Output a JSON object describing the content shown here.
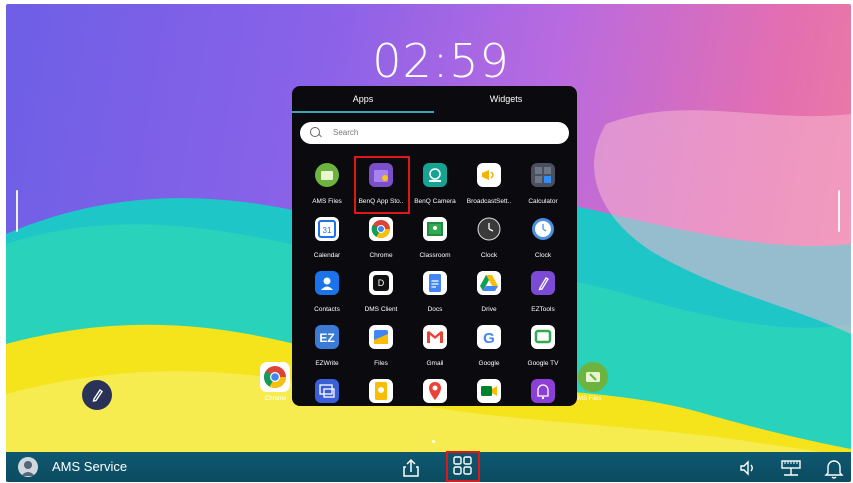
{
  "clock": {
    "time": "02:59"
  },
  "drawer": {
    "tabs": [
      {
        "label": "Apps",
        "active": true
      },
      {
        "label": "Widgets",
        "active": false
      }
    ],
    "search_placeholder": "Search",
    "apps": [
      {
        "label": "AMS Files",
        "icon": "ams-files-icon",
        "color": "#6db33f"
      },
      {
        "label": "BenQ App Sto..",
        "icon": "benq-app-store-icon",
        "color": "#7a4fc9",
        "highlighted": true
      },
      {
        "label": "BenQ Camera",
        "icon": "benq-camera-icon",
        "color": "#16a394"
      },
      {
        "label": "BroadcastSett..",
        "icon": "broadcast-settings-icon",
        "color": "#f5b400"
      },
      {
        "label": "Calculator",
        "icon": "calculator-icon",
        "color": "#4a5060"
      },
      {
        "label": "Calendar",
        "icon": "calendar-icon",
        "color": "#ffffff"
      },
      {
        "label": "Chrome",
        "icon": "chrome-icon",
        "color": "#ffffff"
      },
      {
        "label": "Classroom",
        "icon": "classroom-icon",
        "color": "#ffffff"
      },
      {
        "label": "Clock",
        "icon": "clock-icon",
        "color": "#2b2b2b"
      },
      {
        "label": "Clock",
        "icon": "clock-icon",
        "color": "#4a90e2"
      },
      {
        "label": "Contacts",
        "icon": "contacts-icon",
        "color": "#1a73e8"
      },
      {
        "label": "DMS Client",
        "icon": "dms-client-icon",
        "color": "#ffffff"
      },
      {
        "label": "Docs",
        "icon": "docs-icon",
        "color": "#ffffff"
      },
      {
        "label": "Drive",
        "icon": "drive-icon",
        "color": "#ffffff"
      },
      {
        "label": "EZTools",
        "icon": "eztools-icon",
        "color": "#7b4bd6"
      },
      {
        "label": "EZWrite",
        "icon": "ezwrite-icon",
        "color": "#3b7bd6"
      },
      {
        "label": "Files",
        "icon": "files-icon",
        "color": "#ffffff"
      },
      {
        "label": "Gmail",
        "icon": "gmail-icon",
        "color": "#ffffff"
      },
      {
        "label": "Google",
        "icon": "google-icon",
        "color": "#ffffff"
      },
      {
        "label": "Google TV",
        "icon": "google-tv-icon",
        "color": "#ffffff"
      },
      {
        "label": "",
        "icon": "screen-share-icon",
        "color": "#3b5fd6"
      },
      {
        "label": "",
        "icon": "keep-icon",
        "color": "#ffffff"
      },
      {
        "label": "",
        "icon": "maps-icon",
        "color": "#ffffff"
      },
      {
        "label": "",
        "icon": "meet-icon",
        "color": "#ffffff"
      },
      {
        "label": "",
        "icon": "alarm-icon",
        "color": "#8b3fd6"
      }
    ]
  },
  "desktop": {
    "left_app": {
      "label": "Chrome",
      "icon": "chrome-icon"
    },
    "right_app": {
      "label": "AMS Files",
      "icon": "ams-files-icon"
    }
  },
  "taskbar": {
    "user": "AMS Service",
    "icons": [
      "share-screen-icon",
      "apps-grid-icon",
      "volume-icon",
      "network-icon",
      "notification-bell-icon"
    ],
    "apps_highlighted": true
  }
}
